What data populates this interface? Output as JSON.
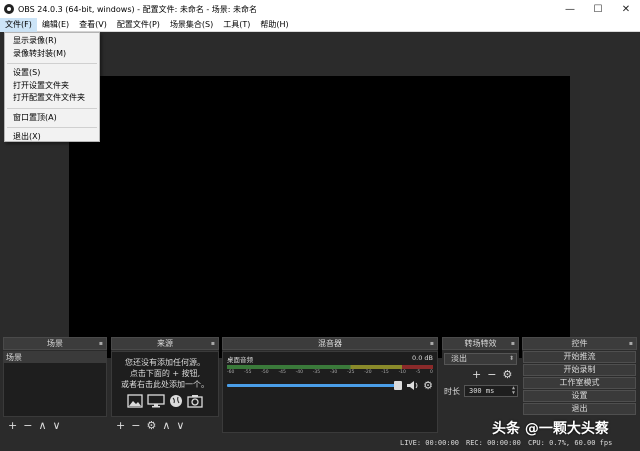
{
  "window": {
    "title": "OBS 24.0.3 (64-bit, windows) - 配置文件: 未命名 - 场景: 未命名",
    "minimize": "—",
    "maximize": "☐",
    "close": "✕"
  },
  "menubar": [
    "文件(F)",
    "编辑(E)",
    "查看(V)",
    "配置文件(P)",
    "场景集合(S)",
    "工具(T)",
    "帮助(H)"
  ],
  "file_menu": {
    "group1": [
      "显示录像(R)",
      "录像转封装(M)"
    ],
    "group2": [
      "设置(S)",
      "打开设置文件夹",
      "打开配置文件文件夹"
    ],
    "group3": [
      "窗口置顶(A)"
    ],
    "group4": [
      "退出(X)"
    ]
  },
  "docks": {
    "scenes": {
      "title": "场景",
      "items": [
        "场景"
      ]
    },
    "sources": {
      "title": "来源",
      "empty_lines": [
        "您还没有添加任何源。",
        "点击下面的 + 按钮,",
        "或者右击此处添加一个。"
      ]
    },
    "mixer": {
      "title": "混音器",
      "channel_name": "桌面音频",
      "level": "0.0 dB",
      "ticks": [
        "-60",
        "-55",
        "-50",
        "-45",
        "-40",
        "-35",
        "-30",
        "-25",
        "-20",
        "-15",
        "-10",
        "-5",
        "0"
      ]
    },
    "transitions": {
      "title": "转场特效",
      "selected": "淡出",
      "duration_label": "时长",
      "duration_value": "300 ms"
    },
    "controls": {
      "title": "控件",
      "buttons": [
        "开始推流",
        "开始录制",
        "工作室模式",
        "设置",
        "退出"
      ]
    }
  },
  "statusbar": {
    "live": "LIVE: 00:00:00",
    "rec": "REC: 00:00:00",
    "cpu": "CPU: 0.7%, 60.00 fps"
  },
  "watermark": "头条 @一颗大头蔡"
}
